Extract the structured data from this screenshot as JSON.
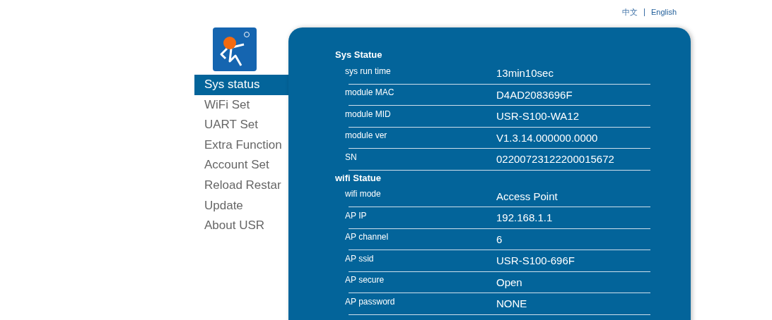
{
  "languages": [
    {
      "label": "中文",
      "selected": false
    },
    {
      "label": "English",
      "selected": true
    }
  ],
  "sidebar": {
    "items": [
      {
        "label": "Sys status",
        "selected": true
      },
      {
        "label": "WiFi Set",
        "selected": false
      },
      {
        "label": "UART Set",
        "selected": false
      },
      {
        "label": "Extra Function",
        "selected": false
      },
      {
        "label": "Account Set",
        "selected": false
      },
      {
        "label": "Reload Restar",
        "selected": false
      },
      {
        "label": "Update",
        "selected": false
      },
      {
        "label": "About USR",
        "selected": false
      }
    ]
  },
  "sections": [
    {
      "title": "Sys Statue",
      "rows": [
        {
          "label": "sys run time",
          "value": "13min10sec"
        },
        {
          "label": "module MAC",
          "value": "D4AD2083696F"
        },
        {
          "label": "module MID",
          "value": "USR-S100-WA12"
        },
        {
          "label": "module ver",
          "value": "V1.3.14.000000.0000"
        },
        {
          "label": "SN",
          "value": "02200723122200015672"
        }
      ]
    },
    {
      "title": "wifi Statue",
      "rows": [
        {
          "label": "wifi mode",
          "value": "Access Point"
        },
        {
          "label": "AP IP",
          "value": "192.168.1.1"
        },
        {
          "label": "AP channel",
          "value": "6"
        },
        {
          "label": "AP ssid",
          "value": "USR-S100-696F"
        },
        {
          "label": "AP secure",
          "value": "Open"
        },
        {
          "label": "AP password",
          "value": "NONE"
        }
      ]
    }
  ]
}
